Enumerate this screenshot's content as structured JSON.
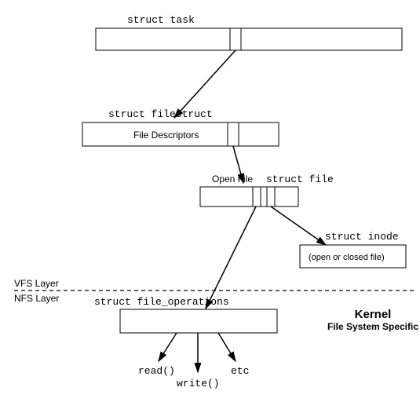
{
  "nodes": {
    "task": {
      "title": "struct task"
    },
    "filestruct": {
      "title": "struct filestruct",
      "label": "File Descriptors"
    },
    "file": {
      "title": "struct file",
      "label_left": "Open File"
    },
    "inode": {
      "title": "struct inode",
      "label": "(open or closed file)"
    },
    "fops": {
      "title": "struct file_operations"
    },
    "calls": {
      "read": "read()",
      "write": "write()",
      "etc": "etc"
    }
  },
  "layers": {
    "upper": "VFS Layer",
    "lower": "NFS Layer"
  },
  "annotation": {
    "title": "Kernel",
    "subtitle": "File System Specific"
  }
}
